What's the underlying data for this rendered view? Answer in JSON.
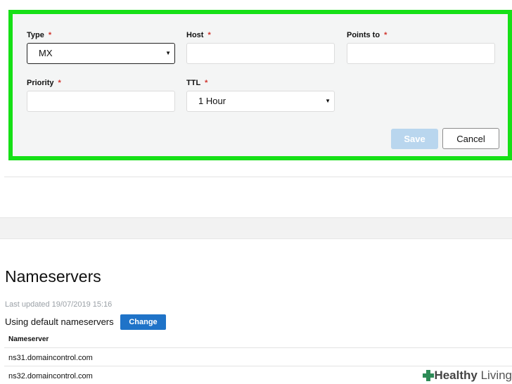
{
  "form": {
    "type_label": "Type",
    "host_label": "Host",
    "points_to_label": "Points to",
    "priority_label": "Priority",
    "ttl_label": "TTL",
    "required_mark": "*",
    "type_value": "MX",
    "host_value": "",
    "points_to_value": "",
    "priority_value": "",
    "ttl_value": "1 Hour",
    "caret": "▼",
    "save_label": "Save",
    "cancel_label": "Cancel",
    "highlight_color": "#16e016"
  },
  "nameservers": {
    "title": "Nameservers",
    "last_updated": "Last updated 19/07/2019 15:16",
    "using_text": "Using default nameservers",
    "change_label": "Change",
    "column_header": "Nameserver",
    "rows": [
      "ns31.domaincontrol.com",
      "ns32.domaincontrol.com"
    ]
  },
  "watermark": {
    "bold": "Healthy",
    "rest": " Living"
  }
}
